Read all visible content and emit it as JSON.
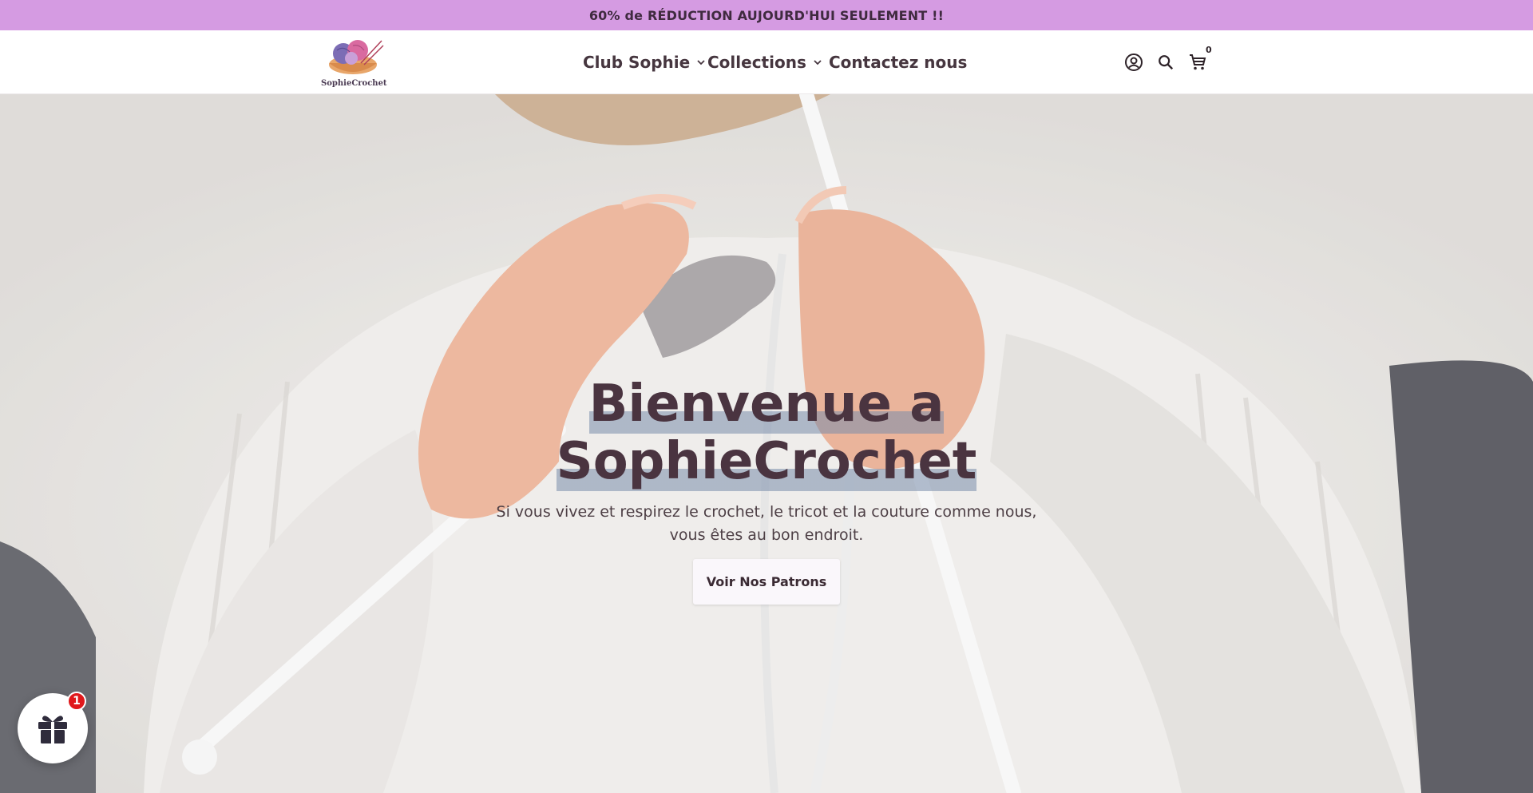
{
  "announcement": {
    "text": "60% de RÉDUCTION AUJOURD'HUI SEULEMENT !!"
  },
  "header": {
    "logo_text": "SophieCrochet",
    "nav": [
      {
        "label": "Club Sophie",
        "has_dropdown": true
      },
      {
        "label": "Collections",
        "has_dropdown": true
      },
      {
        "label": "Contactez nous",
        "has_dropdown": false
      }
    ],
    "icons": {
      "account": "account-icon",
      "search": "search-icon",
      "cart": "cart-icon"
    },
    "cart_count": "0"
  },
  "hero": {
    "title_line1": "Bienvenue a",
    "title_line2": "SophieCrochet",
    "subtitle": "Si vous vivez et respirez le crochet, le tricot et la couture comme nous, vous êtes au bon endroit.",
    "button_label": "Voir Nos Patrons"
  },
  "gift_widget": {
    "icon": "gift-icon",
    "badge_count": "1"
  },
  "colors": {
    "announcement_bg": "#d59be2",
    "heading": "#4a3440",
    "badge": "#e0181b"
  }
}
